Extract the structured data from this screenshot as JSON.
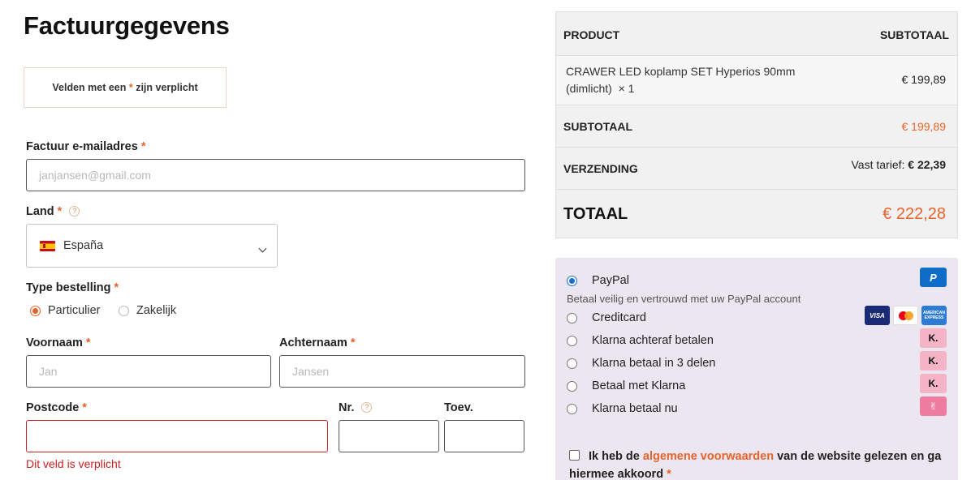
{
  "form": {
    "title": "Factuurgegevens",
    "notice_prefix": "Velden met een ",
    "notice_star": "*",
    "notice_suffix": " zijn verplicht",
    "email": {
      "label": "Factuur e-mailadres",
      "placeholder": "janjansen@gmail.com"
    },
    "country": {
      "label": "Land",
      "help": "?",
      "selected": "España"
    },
    "order_type": {
      "label": "Type bestelling",
      "options": [
        "Particulier",
        "Zakelijk"
      ],
      "selected": "Particulier"
    },
    "first_name": {
      "label": "Voornaam",
      "placeholder": "Jan"
    },
    "last_name": {
      "label": "Achternaam",
      "placeholder": "Jansen"
    },
    "postcode": {
      "label": "Postcode",
      "value": "",
      "error": "Dit veld is verplicht"
    },
    "number": {
      "label": "Nr.",
      "help": "?"
    },
    "addition": {
      "label": "Toev."
    },
    "required_mark": "*"
  },
  "order": {
    "col_product": "PRODUCT",
    "col_subtotal": "SUBTOTAAL",
    "product": {
      "name_line1": "CRAWER LED koplamp SET Hyperios 90mm",
      "name_line2": "(dimlicht)",
      "qty": "× 1",
      "price": "€ 199,89"
    },
    "subtotal": {
      "label": "SUBTOTAAL",
      "value": "€ 199,89"
    },
    "shipping": {
      "label": "VERZENDING",
      "method": "Vast tarief:",
      "value": "€ 22,39"
    },
    "total": {
      "label": "TOTAAL",
      "value": "€ 222,28"
    }
  },
  "payment": {
    "options": [
      {
        "label": "PayPal",
        "selected": true
      },
      {
        "label": "Creditcard",
        "selected": false
      },
      {
        "label": "Klarna achteraf betalen",
        "selected": false
      },
      {
        "label": "Klarna betaal in 3 delen",
        "selected": false
      },
      {
        "label": "Betaal met Klarna",
        "selected": false
      },
      {
        "label": "Klarna betaal nu",
        "selected": false
      }
    ],
    "paypal_desc": "Betaal veilig en vertrouwd met uw PayPal account",
    "terms_prefix": "Ik heb de ",
    "terms_link": "algemene voorwaarden",
    "terms_suffix": " van de website gelezen en ga hiermee akkoord",
    "terms_star": "*"
  },
  "colors": {
    "accent": "#e8642c",
    "error": "#cc1f1f",
    "paypal": "#0f6cc7",
    "klarna": "#f4b4c5"
  }
}
